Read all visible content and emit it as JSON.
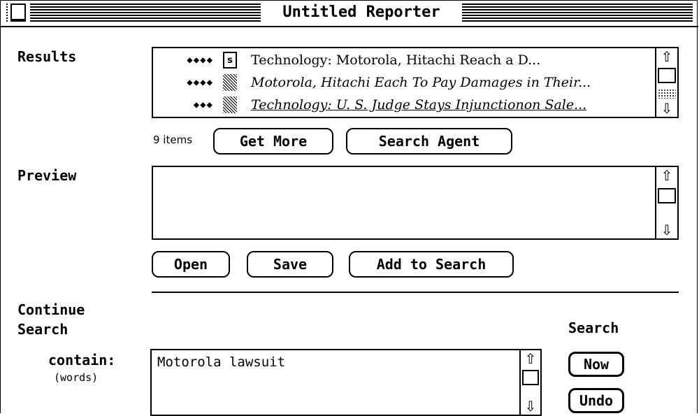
{
  "window": {
    "title": "Untitled Reporter"
  },
  "results": {
    "label": "Results",
    "items": [
      {
        "rating": "◆◆◆◆",
        "icon": "s",
        "title": "Technology: Motorola, Hitachi Reach a D...",
        "italic": false
      },
      {
        "rating": "◆◆◆◆",
        "icon": "",
        "title": "Motorola, Hitachi Each To Pay Damages in Their...",
        "italic": true
      },
      {
        "rating": "◆◆◆",
        "icon": "",
        "title": "Technology: U. S. Judge Stays Injunctionon Sale...",
        "italic": true
      }
    ],
    "count": "9 items",
    "get_more": "Get More",
    "search_agent": "Search Agent"
  },
  "preview": {
    "label": "Preview",
    "open": "Open",
    "save": "Save",
    "add_to_search": "Add to Search"
  },
  "continue": {
    "label_line1": "Continue",
    "label_line2": "Search",
    "search_label": "Search",
    "contain_label": "contain:",
    "words_label": "(words)",
    "query": "Motorola lawsuit",
    "now": "Now",
    "undo": "Undo"
  }
}
